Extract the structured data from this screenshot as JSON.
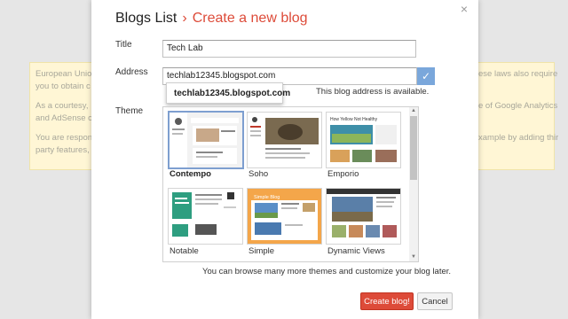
{
  "banner": {
    "left_lines": [
      "European Union",
      "you to obtain c",
      "",
      "As a courtesy,",
      "and AdSense c",
      "",
      "You are respon",
      "party features,"
    ],
    "right_lines": [
      "ese laws also require",
      "",
      "",
      "e of Google Analytics",
      "",
      "",
      "xample by adding third",
      ""
    ]
  },
  "dialog": {
    "close_icon": "×",
    "breadcrumb_parent": "Blogs List",
    "breadcrumb_sep": "›",
    "breadcrumb_current": "Create a new blog",
    "title_label": "Title",
    "title_value": "Tech Lab",
    "address_label": "Address",
    "address_value": "techlab12345.blogspot.com",
    "address_suggestion": "techlab12345.blogspot.com",
    "address_status": "This blog address is available.",
    "check_icon": "✓",
    "theme_label": "Theme",
    "themes": [
      {
        "name": "Contempo",
        "selected": true
      },
      {
        "name": "Soho",
        "selected": false
      },
      {
        "name": "Emporio",
        "selected": false
      },
      {
        "name": "Notable",
        "selected": false
      },
      {
        "name": "Simple",
        "selected": false
      },
      {
        "name": "Dynamic Views",
        "selected": false
      }
    ],
    "thumb_text": {
      "emporio_title": "How Yellow Not Healthy",
      "simple_title": "Simple Blog"
    },
    "themes_note": "You can browse many more themes and customize your blog later.",
    "create_button": "Create blog!",
    "cancel_button": "Cancel"
  },
  "colors": {
    "accent": "#dd4b39",
    "selected_border": "#7e9fd0",
    "check_bg": "#7aa7db"
  }
}
